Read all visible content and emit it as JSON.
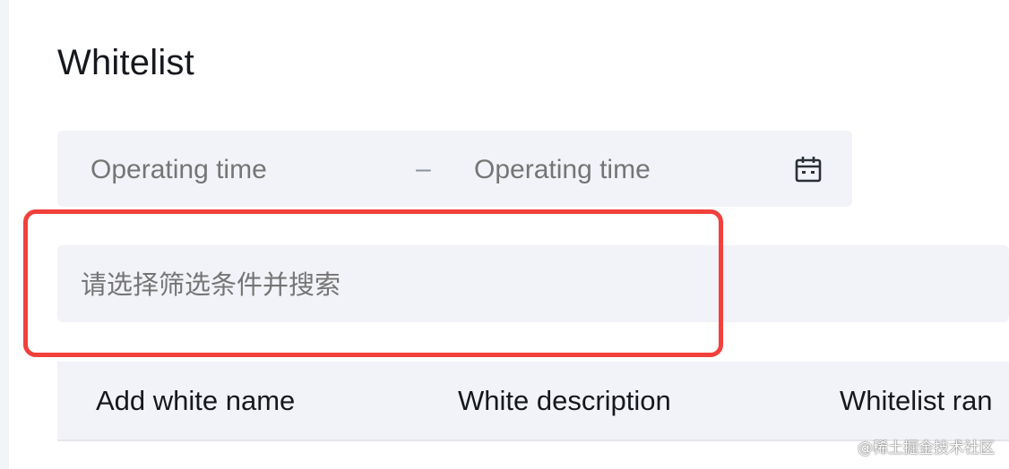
{
  "page": {
    "title": "Whitelist"
  },
  "date_range": {
    "start_placeholder": "Operating time",
    "separator": "–",
    "end_placeholder": "Operating time",
    "icon": "calendar-icon"
  },
  "filter": {
    "placeholder": "请选择筛选条件并搜索"
  },
  "table": {
    "columns": [
      "Add white name",
      "White description",
      "Whitelist ran"
    ]
  },
  "watermark": {
    "text": "@稀土掘金技术社区"
  },
  "colors": {
    "highlight": "#f2403c",
    "input_bg": "#f2f3f8",
    "placeholder": "#8c929c",
    "text": "#15181d"
  }
}
